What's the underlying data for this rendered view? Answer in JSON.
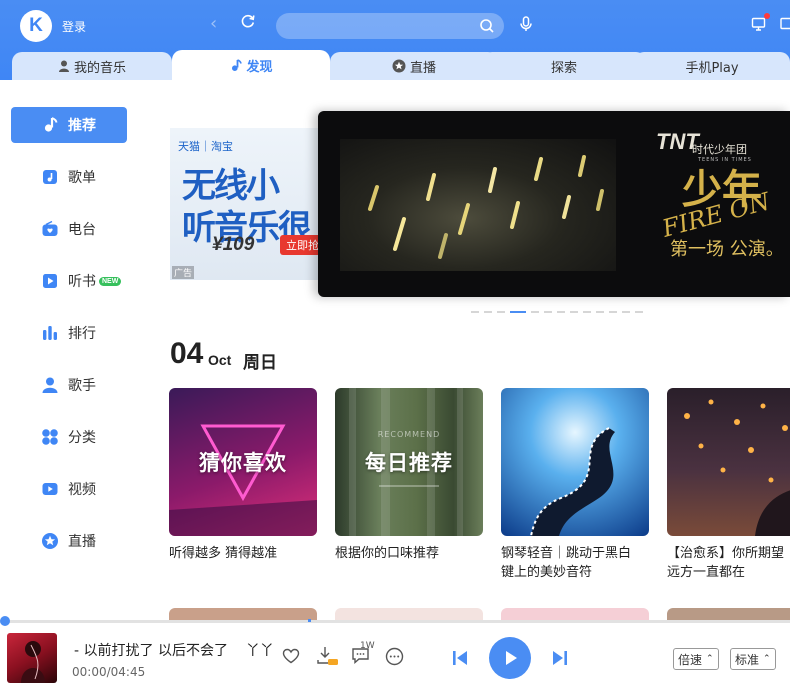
{
  "header": {
    "logo_letter": "K",
    "login": "登录",
    "search_placeholder": ""
  },
  "tabs": [
    {
      "label": "我的音乐",
      "icon": "user-icon"
    },
    {
      "label": "发现",
      "icon": "music-note-icon",
      "active": true
    },
    {
      "label": "直播",
      "icon": "star-icon"
    },
    {
      "label": "探索"
    },
    {
      "label": "手机Play"
    }
  ],
  "sidebar": {
    "items": [
      {
        "label": "推荐",
        "icon": "music-note-icon",
        "active": true
      },
      {
        "label": "歌单",
        "icon": "playlist-icon"
      },
      {
        "label": "电台",
        "icon": "radio-icon"
      },
      {
        "label": "听书",
        "icon": "book-icon",
        "badge": "NEW"
      },
      {
        "label": "排行",
        "icon": "chart-icon"
      },
      {
        "label": "歌手",
        "icon": "singer-icon"
      },
      {
        "label": "分类",
        "icon": "category-icon"
      },
      {
        "label": "视频",
        "icon": "video-icon"
      },
      {
        "label": "直播",
        "icon": "star-icon"
      }
    ]
  },
  "banner": {
    "ad": {
      "head": "天猫｜淘宝",
      "line1": "无线小",
      "line2": "听音乐很",
      "price": "¥109",
      "buy": "立即抢",
      "mark": "广告"
    },
    "main": {
      "logo": "TNT",
      "logo_sub": "时代少年团",
      "logo_en": "TEENS IN TIMES",
      "big_text": "少年",
      "fire_text": "FIRE ON",
      "bottom_text": "第一场 公演。"
    },
    "dots_count": 13,
    "active_dot": 3
  },
  "date": {
    "day": "04",
    "month": "Oct",
    "weekday": "周日"
  },
  "cards": [
    {
      "cover_title": "猜你喜欢",
      "caption": [
        "听得越多 猜得越准"
      ]
    },
    {
      "cover_title": "每日推荐",
      "cover_sub": "RECOMMEND",
      "caption": [
        "根据你的口味推荐"
      ]
    },
    {
      "cover_title": "",
      "caption": [
        "钢琴轻音｜跳动于黑白",
        "键上的美妙音符"
      ]
    },
    {
      "cover_title": "",
      "caption": [
        "【治愈系】你所期望",
        "远方一直都在"
      ]
    }
  ],
  "player": {
    "song": "- 以前打扰了 以后不会了",
    "artist": "丫丫",
    "time": "00:00/04:45",
    "progress_fraction": 0.0,
    "comment_count": "1W",
    "speed_label": "倍速",
    "quality_label": "标准"
  },
  "colors": {
    "accent": "#4a8df3",
    "tab_inactive": "#d7e6fc",
    "new_badge": "#36c05c"
  }
}
